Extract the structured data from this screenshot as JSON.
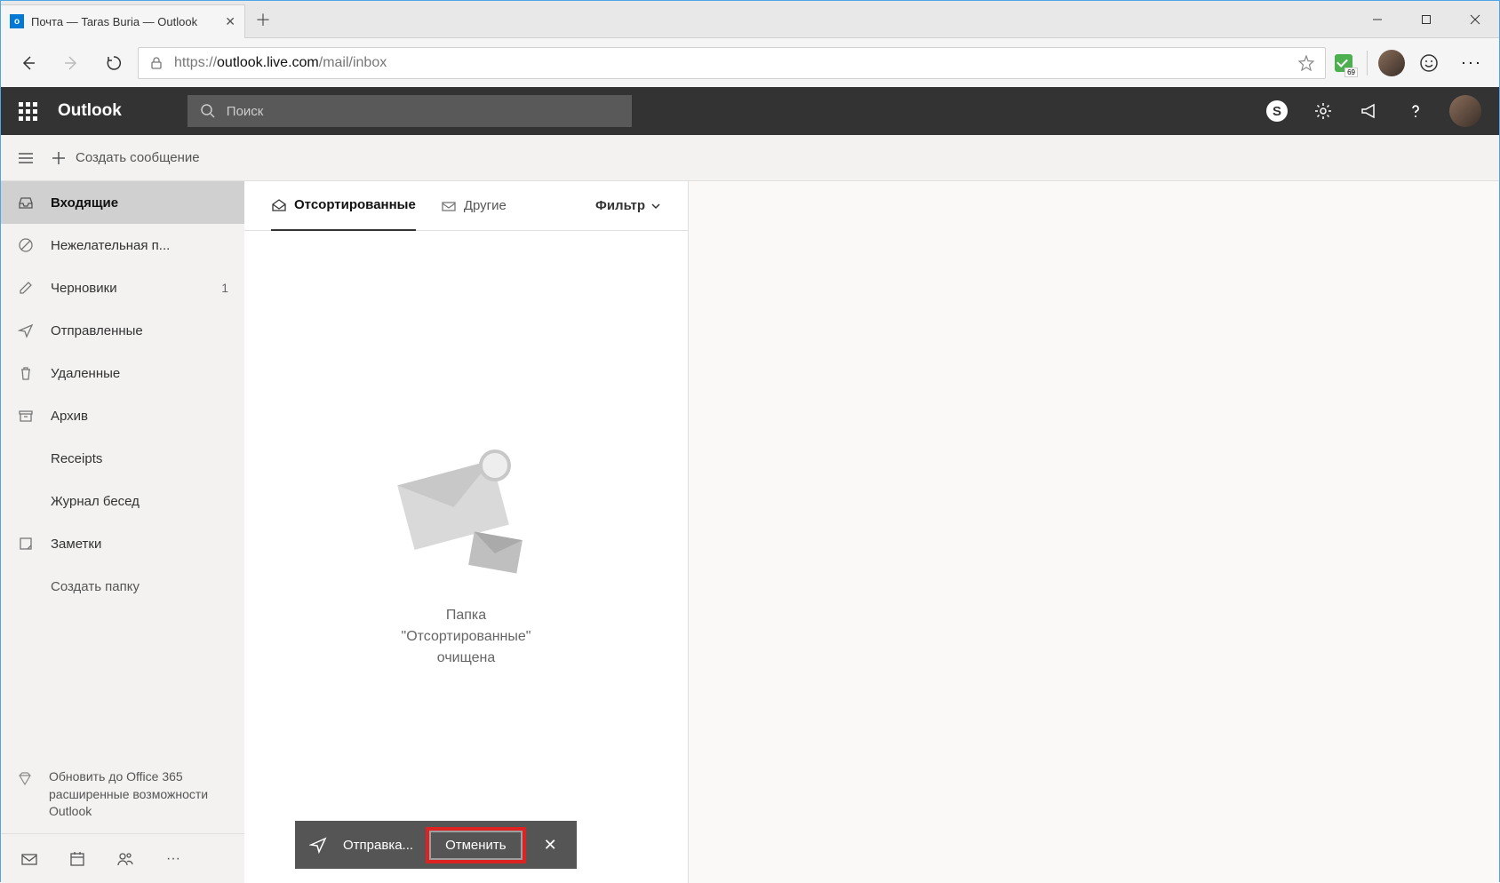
{
  "window": {
    "tab_title": "Почта — Taras Buria — Outlook"
  },
  "address": {
    "prefix": "https://",
    "host": "outlook.live.com",
    "path": "/mail/inbox",
    "ext_badge": "69"
  },
  "header": {
    "app_title": "Outlook",
    "search_placeholder": "Поиск"
  },
  "command": {
    "new_message": "Создать сообщение"
  },
  "folders": {
    "inbox": "Входящие",
    "junk": "Нежелательная п...",
    "drafts": "Черновики",
    "drafts_count": "1",
    "sent": "Отправленные",
    "deleted": "Удаленные",
    "archive": "Архив",
    "receipts": "Receipts",
    "history": "Журнал бесед",
    "notes": "Заметки",
    "newfolder": "Создать папку"
  },
  "upgrade": {
    "text": "Обновить до Office 365 расширенные возможности Outlook"
  },
  "listpane": {
    "tab_focused": "Отсортированные",
    "tab_other": "Другие",
    "filter": "Фильтр",
    "empty_line1": "Папка",
    "empty_line2": "\"Отсортированные\"",
    "empty_line3": "очищена"
  },
  "toast": {
    "sending": "Отправка...",
    "cancel": "Отменить"
  }
}
